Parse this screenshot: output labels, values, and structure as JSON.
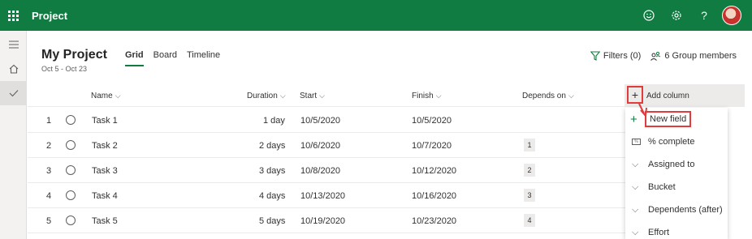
{
  "app": {
    "title": "Project"
  },
  "project": {
    "name": "My Project",
    "dates": "Oct 5 - Oct 23"
  },
  "tabs": [
    {
      "label": "Grid",
      "active": true
    },
    {
      "label": "Board",
      "active": false
    },
    {
      "label": "Timeline",
      "active": false
    }
  ],
  "header": {
    "filters_label": "Filters (0)",
    "members_label": "6 Group members"
  },
  "columns": {
    "name": "Name",
    "duration": "Duration",
    "start": "Start",
    "finish": "Finish",
    "depends_on": "Depends on",
    "add_column": "Add column"
  },
  "tasks": [
    {
      "num": "1",
      "name": "Task 1",
      "duration": "1 day",
      "start": "10/5/2020",
      "finish": "10/5/2020",
      "depends_on": ""
    },
    {
      "num": "2",
      "name": "Task 2",
      "duration": "2 days",
      "start": "10/6/2020",
      "finish": "10/7/2020",
      "depends_on": "1"
    },
    {
      "num": "3",
      "name": "Task 3",
      "duration": "3 days",
      "start": "10/8/2020",
      "finish": "10/12/2020",
      "depends_on": "2"
    },
    {
      "num": "4",
      "name": "Task 4",
      "duration": "4 days",
      "start": "10/13/2020",
      "finish": "10/16/2020",
      "depends_on": "3"
    },
    {
      "num": "5",
      "name": "Task 5",
      "duration": "5 days",
      "start": "10/19/2020",
      "finish": "10/23/2020",
      "depends_on": "4"
    }
  ],
  "menu": {
    "items": [
      {
        "label": "New field",
        "icon": "plus-icon"
      },
      {
        "label": "% complete",
        "icon": "percent-icon"
      },
      {
        "label": "Assigned to",
        "icon": "chevron-down-icon"
      },
      {
        "label": "Bucket",
        "icon": "chevron-down-icon"
      },
      {
        "label": "Dependents (after)",
        "icon": "chevron-down-icon"
      },
      {
        "label": "Effort",
        "icon": "chevron-down-icon"
      }
    ]
  },
  "colors": {
    "brand": "#107c41",
    "highlight": "#e03c3c"
  }
}
